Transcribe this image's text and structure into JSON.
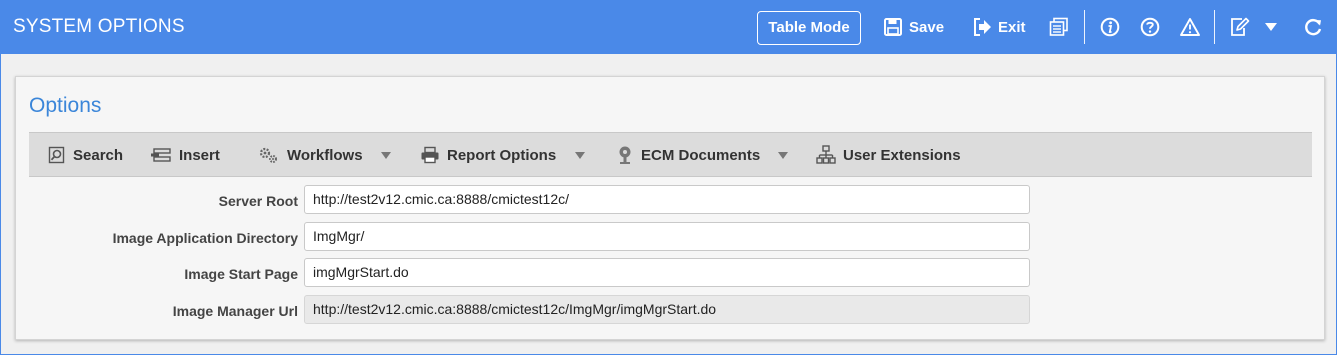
{
  "header": {
    "title": "SYSTEM OPTIONS",
    "table_mode_label": "Table Mode",
    "save_label": "Save",
    "exit_label": "Exit"
  },
  "panel": {
    "title": "Options"
  },
  "actions": {
    "search": "Search",
    "insert": "Insert",
    "workflows": "Workflows",
    "report_options": "Report Options",
    "ecm_documents": "ECM Documents",
    "user_extensions": "User Extensions"
  },
  "fields": {
    "server_root": {
      "label": "Server Root",
      "value": "http://test2v12.cmic.ca:8888/cmictest12c/"
    },
    "image_app_dir": {
      "label": "Image Application Directory",
      "value": "ImgMgr/"
    },
    "image_start_page": {
      "label": "Image Start Page",
      "value": "imgMgrStart.do"
    },
    "image_manager_url": {
      "label": "Image Manager Url",
      "value": "http://test2v12.cmic.ca:8888/cmictest12c/ImgMgr/imgMgrStart.do"
    }
  },
  "colors": {
    "header_bg": "#4a89e8",
    "panel_title": "#3b86d9"
  }
}
